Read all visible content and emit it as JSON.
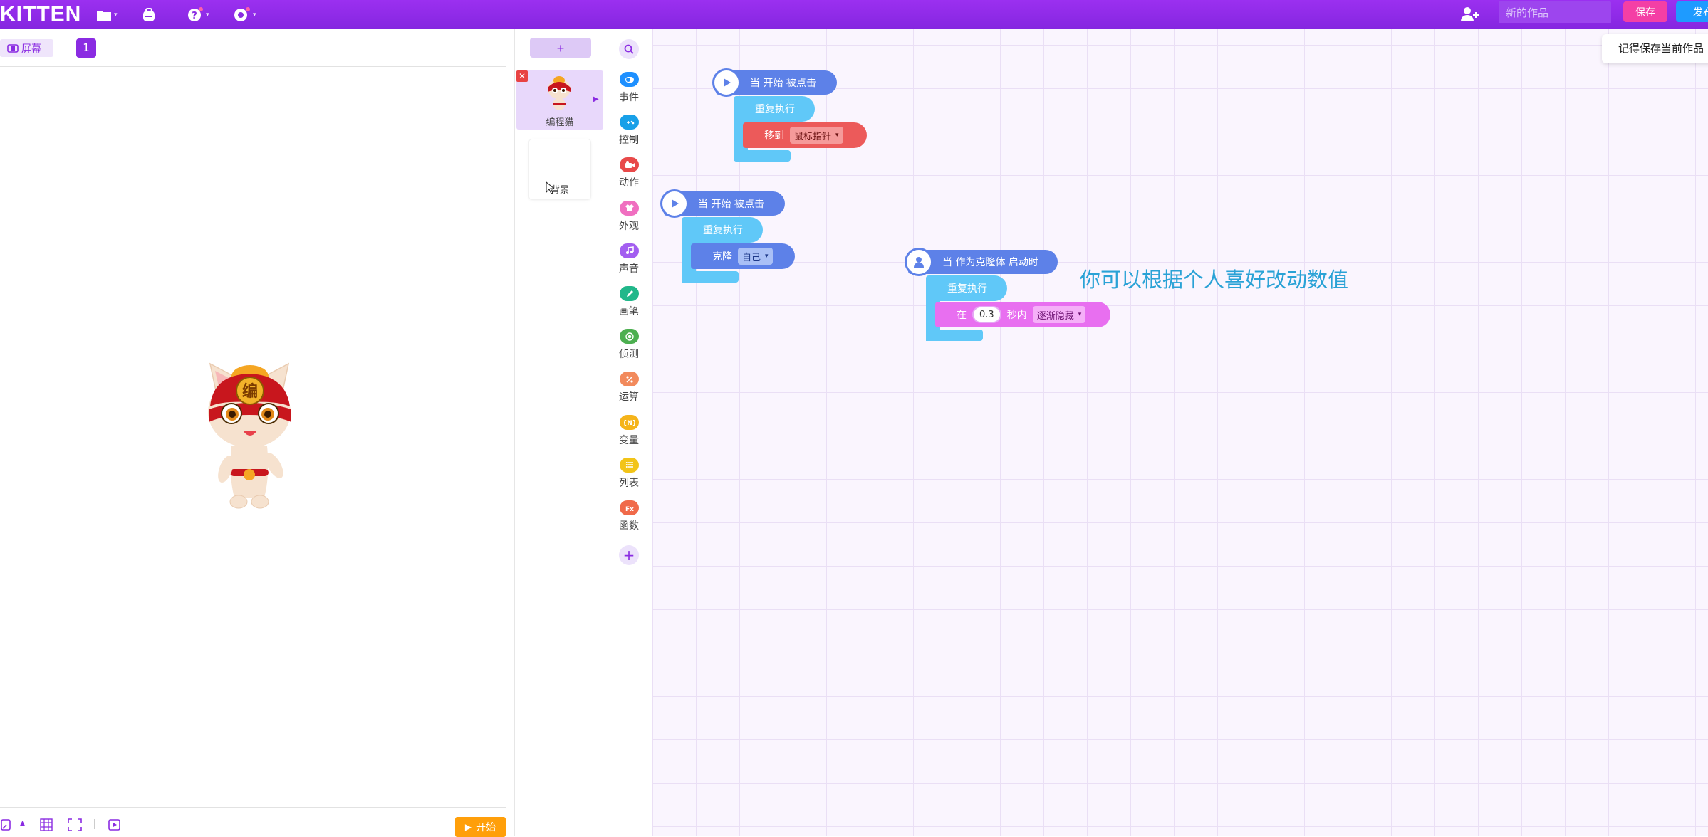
{
  "app": {
    "logo": "KITTEN"
  },
  "topbar": {
    "work_name_placeholder": "新的作品",
    "save_label": "保存",
    "publish_label": "发布"
  },
  "stage": {
    "screen_toggle_label": "屏幕",
    "screen_number": "1",
    "start_label": "开始"
  },
  "sprites": {
    "add_label": "+",
    "items": [
      {
        "name": "编程猫"
      }
    ],
    "background_label": "背景"
  },
  "categories": [
    {
      "label": "事件",
      "color": "#1e90ff",
      "icon": "toggle-icon"
    },
    {
      "label": "控制",
      "color": "#18a0e8",
      "icon": "gamepad-icon"
    },
    {
      "label": "动作",
      "color": "#e84a4a",
      "icon": "motion-icon"
    },
    {
      "label": "外观",
      "color": "#f06fc0",
      "icon": "shirt-icon"
    },
    {
      "label": "声音",
      "color": "#a35ef0",
      "icon": "music-icon"
    },
    {
      "label": "画笔",
      "color": "#21b78a",
      "icon": "pen-icon"
    },
    {
      "label": "侦测",
      "color": "#4caf50",
      "icon": "radar-icon"
    },
    {
      "label": "运算",
      "color": "#f28a5c",
      "icon": "percent-icon"
    },
    {
      "label": "变量",
      "color": "#f5b41a",
      "icon": "variable-icon"
    },
    {
      "label": "列表",
      "color": "#f2c418",
      "icon": "list-icon"
    },
    {
      "label": "函数",
      "color": "#f06a4a",
      "icon": "function-icon"
    }
  ],
  "workspace": {
    "tip": "记得保存当前作品",
    "comment": "你可以根据个人喜好改动数值",
    "scripts": [
      {
        "hat": "当 开始 被点击",
        "loop": "重复执行",
        "inner_label": "移到",
        "inner_dropdown": "鼠标指针"
      },
      {
        "hat": "当 开始 被点击",
        "loop": "重复执行",
        "inner_label": "克隆",
        "inner_dropdown": "自己"
      },
      {
        "hat": "当 作为克隆体 启动时",
        "loop": "重复执行",
        "inner_prefix": "在",
        "inner_value": "0.3",
        "inner_suffix": "秒内",
        "inner_dropdown": "逐渐隐藏"
      }
    ]
  },
  "colors": {
    "brand_purple": "#8a2be2",
    "event_blue": "#5d81e8",
    "loop_cyan": "#60c8f8",
    "motion_red": "#ec5a5a",
    "looks_pink": "#e86ff0"
  }
}
